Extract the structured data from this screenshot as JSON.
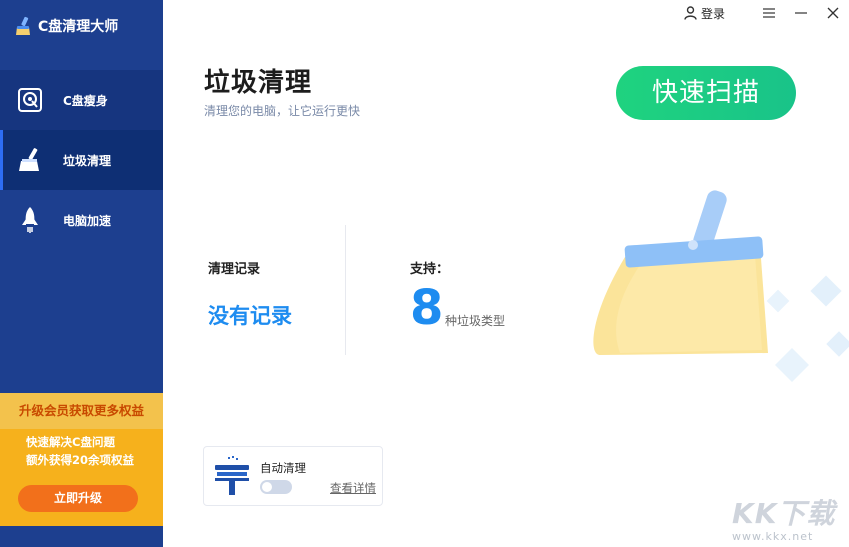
{
  "app": {
    "title": "C盘清理大师"
  },
  "sidebar": {
    "items": [
      {
        "label": "C盘瘦身"
      },
      {
        "label": "垃圾清理"
      },
      {
        "label": "电脑加速"
      }
    ]
  },
  "promo": {
    "title": "升级会员获取更多权益",
    "lines": [
      "快速解决C盘问题",
      "额外获得20余项权益"
    ],
    "button_label": "立即升级"
  },
  "topbar": {
    "login_label": "登录"
  },
  "main": {
    "title": "垃圾清理",
    "subtitle": "清理您的电脑，让它运行更快",
    "scan_button": "快速扫描",
    "record_label": "清理记录",
    "record_value": "没有记录",
    "support_label": "支持：",
    "support_count": "8",
    "support_unit": "种垃圾类型"
  },
  "auto_clean": {
    "label": "自动清理",
    "details_link": "查看详情",
    "enabled": false
  },
  "watermark": {
    "logo": "KK下载",
    "url": "www.kkx.net"
  },
  "colors": {
    "sidebar": "#1d3f8f",
    "sidebar_active": "#0e2f74",
    "accent_blue": "#1e8cf0",
    "scan_green": "#1fd37f",
    "promo_yellow": "#f6b11c",
    "upgrade_orange": "#f2701b"
  }
}
